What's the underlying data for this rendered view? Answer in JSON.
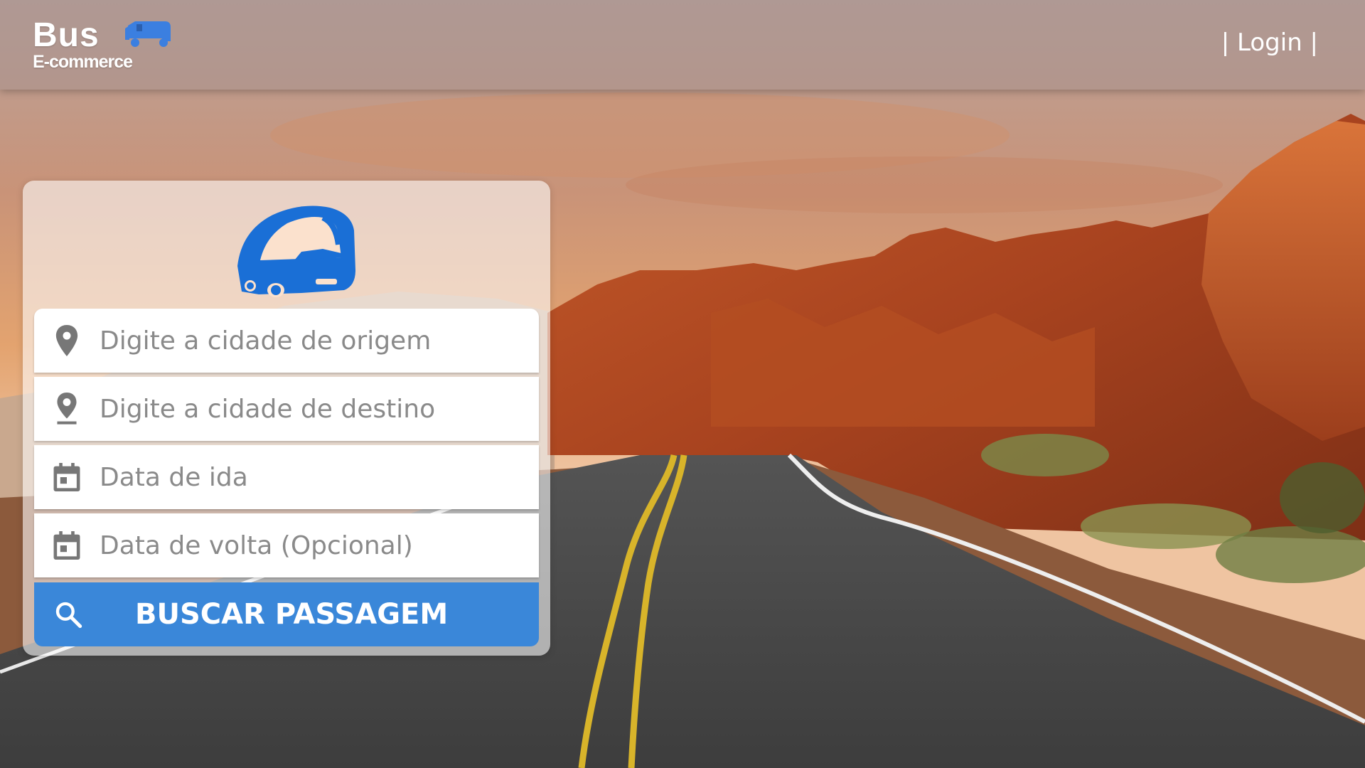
{
  "brand": {
    "name": "Bus",
    "tagline": "E-commerce",
    "accent": "#1a6fd6"
  },
  "header": {
    "login_label": "| Login |"
  },
  "search": {
    "origin_placeholder": "Digite a cidade de origem",
    "destination_placeholder": "Digite a cidade de destino",
    "departure_placeholder": "Data de ida",
    "return_placeholder": "Data de volta (Opcional)",
    "button_label": "BUSCAR PASSAGEM",
    "button_color": "#3a87d9"
  },
  "icons": {
    "origin": "location-pin-icon",
    "destination": "location-pin-icon",
    "departure": "calendar-icon",
    "return": "calendar-icon",
    "search": "search-icon",
    "hero": "bus-icon"
  }
}
